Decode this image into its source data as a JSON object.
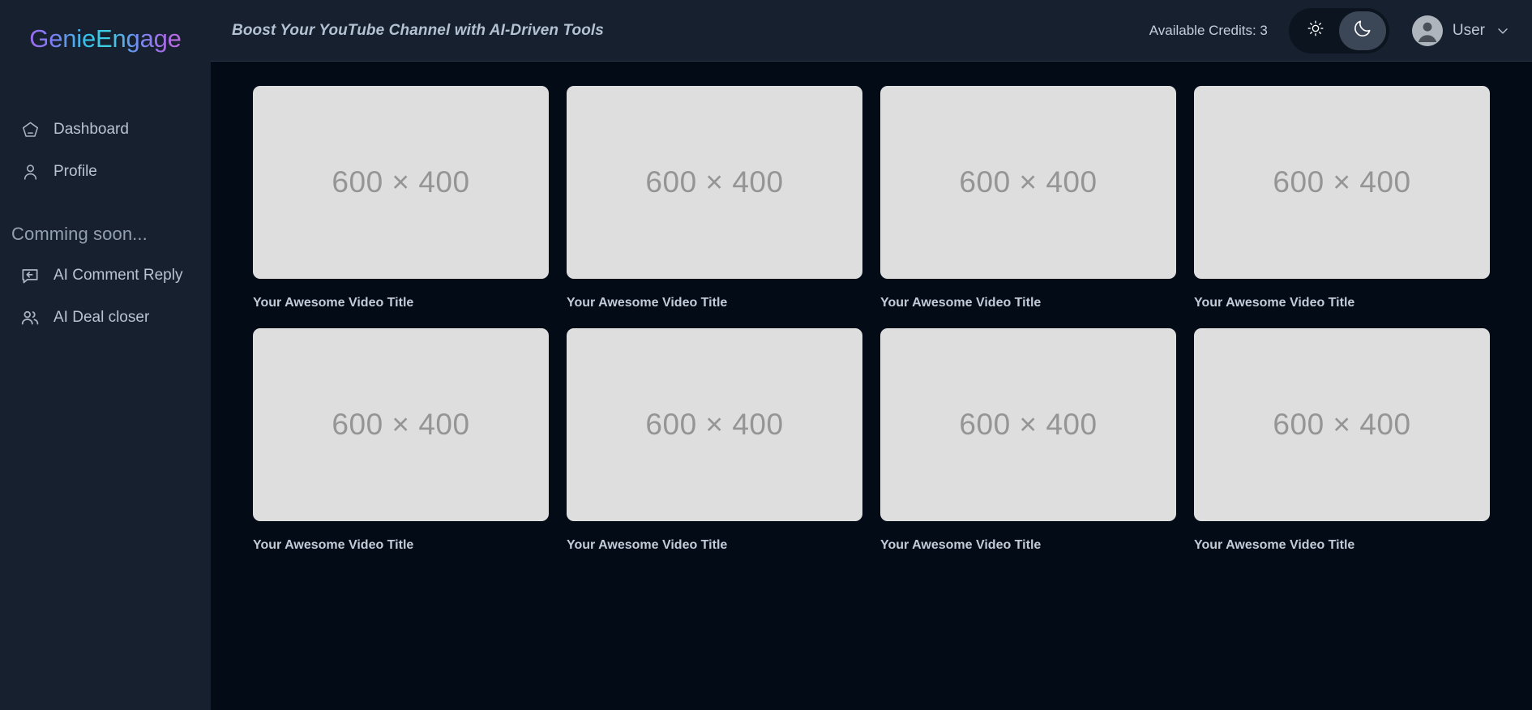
{
  "brand": {
    "name": "GenieEngage",
    "gradient_from": "#9b6cf0",
    "gradient_mid": "#35c3e8",
    "gradient_to": "#c06ae0"
  },
  "sidebar": {
    "items": [
      {
        "label": "Dashboard",
        "icon": "home-icon"
      },
      {
        "label": "Profile",
        "icon": "user-icon"
      }
    ],
    "section_note": "Comming soon...",
    "coming_soon_items": [
      {
        "label": "AI Comment Reply",
        "icon": "message-reply-icon"
      },
      {
        "label": "AI Deal closer",
        "icon": "users-icon"
      }
    ],
    "background": "#16202e"
  },
  "topbar": {
    "title": "Boost Your YouTube Channel with AI-Driven Tools",
    "credits_label": "Available Credits: 3",
    "theme": {
      "light_icon": "sun-icon",
      "dark_icon": "moon-icon",
      "active": "dark"
    },
    "user": {
      "name": "User",
      "avatar_icon": "avatar-person-icon",
      "chevron_icon": "chevron-down-icon"
    },
    "background": "#16202e",
    "border": "#2b3648"
  },
  "content": {
    "placeholder_label": "600 × 400",
    "placeholder_bg": "#dedede",
    "videos": [
      {
        "title": "Your Awesome Video Title",
        "thumb": "600 × 400"
      },
      {
        "title": "Your Awesome Video Title",
        "thumb": "600 × 400"
      },
      {
        "title": "Your Awesome Video Title",
        "thumb": "600 × 400"
      },
      {
        "title": "Your Awesome Video Title",
        "thumb": "600 × 400"
      },
      {
        "title": "Your Awesome Video Title",
        "thumb": "600 × 400"
      },
      {
        "title": "Your Awesome Video Title",
        "thumb": "600 × 400"
      },
      {
        "title": "Your Awesome Video Title",
        "thumb": "600 × 400"
      },
      {
        "title": "Your Awesome Video Title",
        "thumb": "600 × 400"
      }
    ],
    "background": "#030c16"
  }
}
